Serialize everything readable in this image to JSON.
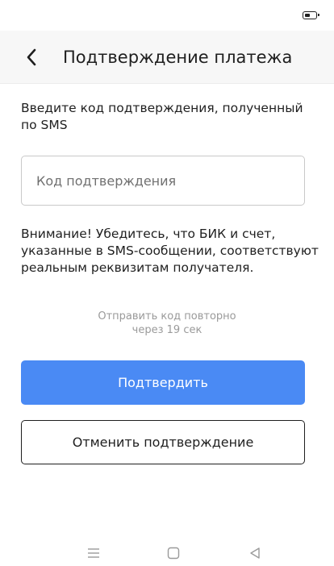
{
  "status_bar": {
    "battery_icon": "battery-icon"
  },
  "header": {
    "title": "Подтверждение платежа",
    "back_icon": "chevron-left-icon"
  },
  "instruction": "Введите код подтверждения, полученный по SMS",
  "code_input": {
    "placeholder": "Код подтверждения",
    "value": ""
  },
  "warning": "Внимание! Убедитесь, что БИК и счет, указанные в SMS-сообщении, соответствуют реальным реквизитам получателя.",
  "resend": {
    "line1": "Отправить код повторно",
    "line2": "через 19 сек"
  },
  "buttons": {
    "confirm": "Подтвердить",
    "cancel": "Отменить подтверждение"
  },
  "colors": {
    "accent": "#4a8af4",
    "text": "#1f1f1f",
    "muted": "#9a9a9a",
    "header_bg": "#f7f7f7"
  },
  "nav_bar": {
    "icons": [
      "menu-icon",
      "home-square-icon",
      "back-triangle-icon"
    ]
  }
}
